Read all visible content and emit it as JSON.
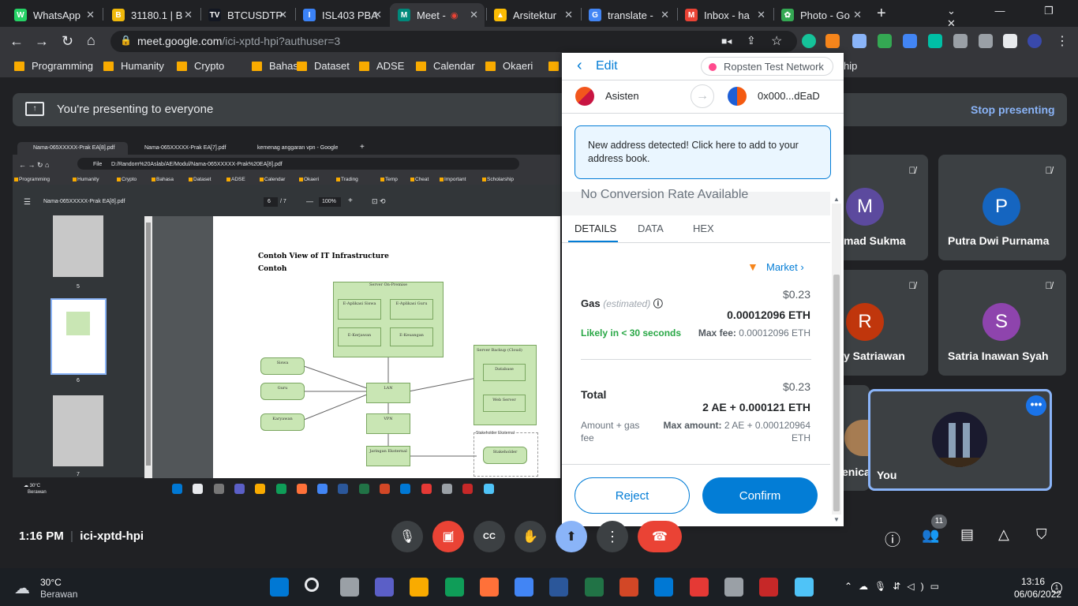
{
  "browser": {
    "tabs": [
      {
        "label": "WhatsApp",
        "color": "#25d366",
        "glyph": "W"
      },
      {
        "label": "31180.1 | B",
        "color": "#f0b90b",
        "glyph": "B"
      },
      {
        "label": "BTCUSDTP",
        "color": "#131722",
        "glyph": "TV"
      },
      {
        "label": "ISL403 PBA",
        "color": "#3b82f6",
        "glyph": "I"
      },
      {
        "label": "Meet -",
        "color": "#00897b",
        "glyph": "M"
      },
      {
        "label": "Arsitektur",
        "color": "#fbbc04",
        "glyph": "▲"
      },
      {
        "label": "translate -",
        "color": "#4285f4",
        "glyph": "G"
      },
      {
        "label": "Inbox - ha",
        "color": "#ea4335",
        "glyph": "M"
      },
      {
        "label": "Photo - Go",
        "color": "#34a853",
        "glyph": "✿"
      }
    ],
    "url_host": "meet.google.com",
    "url_path": "/ici-xptd-hpi?authuser=3",
    "bookmarks": [
      "Programming",
      "Humanity",
      "Crypto",
      "Bahasa",
      "Dataset",
      "ADSE",
      "Calendar",
      "Okaeri",
      "T"
    ],
    "bookmark_overflow": "hip"
  },
  "meet": {
    "presenting_text": "You're presenting to everyone",
    "stop_label": "Stop presenting",
    "time": "1:16 PM",
    "meeting_code": "ici-xptd-hpi",
    "people_count": "11",
    "participants": [
      {
        "initial": "M",
        "name": "mad Sukma",
        "color": "#5c4a9e"
      },
      {
        "initial": "P",
        "name": "Putra Dwi Purnama",
        "color": "#1565c0"
      },
      {
        "initial": "R",
        "name": "y Satriawan",
        "color": "#c0360c"
      },
      {
        "initial": "S",
        "name": "Satria Inawan Syah",
        "color": "#8e44ad"
      },
      {
        "initial": "",
        "name": "enica",
        "color": "#5f6368"
      }
    ],
    "you_label": "You"
  },
  "shared_screen": {
    "tabs": [
      "Nama-065XXXXX-Prak EA[8].pdf",
      "Nama-065XXXXX-Prak EA[7].pdf",
      "kemenag anggaran vpn - Google"
    ],
    "address": "D:/Random%20Aslab/AE/Modul/Nama-065XXXXX-Prak%20EA[8].pdf",
    "file_label": "File",
    "bookmarks": [
      "Programming",
      "Humanity",
      "Crypto",
      "Bahasa",
      "Dataset",
      "ADSE",
      "Calendar",
      "Okaeri",
      "Trading",
      "Temp",
      "Cheat",
      "Important",
      "Scholarship"
    ],
    "pdf_title": "Nama-065XXXXX-Prak EA[8].pdf",
    "page_current": "6",
    "page_total": "/ 7",
    "zoom": "100%",
    "thumb_labels": [
      "5",
      "6",
      "7"
    ],
    "doc_heading1": "Contoh View of IT Infrastructure",
    "doc_heading2": "Contoh",
    "diagram": {
      "server_onprem": "Server On-Premise",
      "apps": [
        "E-Aplikasi Siswa",
        "E-Aplikasi Guru",
        "E-Kerjawan",
        "E-Keuangan"
      ],
      "actors": [
        "Siswa",
        "Guru",
        "Karyawan"
      ],
      "lan": "LAN",
      "vpn": "VPN",
      "jaringan": "Jaringan Eksternal",
      "backup": "Server Backup (Cloud)",
      "database": "Database",
      "webserver": "Web Server",
      "stakeholder_group": "Stakeholder Eksternal",
      "stakeholder": "Stakeholder"
    },
    "weather_temp": "30°C",
    "weather_desc": "Berawan"
  },
  "metamask": {
    "edit_label": "Edit",
    "network": "Ropsten Test Network",
    "from_name": "Asisten",
    "to_address": "0x000...dEaD",
    "alert": "New address detected! Click here to add to your address book.",
    "conversion": "No Conversion Rate Available",
    "tabs": [
      "DETAILS",
      "DATA",
      "HEX"
    ],
    "market_label": "Market",
    "gas_label": "Gas",
    "gas_estimated": "(estimated)",
    "gas_usd": "$0.23",
    "gas_eth": "0.00012096 ETH",
    "likely": "Likely in < 30 seconds",
    "max_fee_label": "Max fee:",
    "max_fee_value": "0.00012096 ETH",
    "total_label": "Total",
    "total_usd": "$0.23",
    "total_eth": "2 AE + 0.000121 ETH",
    "amount_gas_label": "Amount + gas fee",
    "max_amount_label": "Max amount:",
    "max_amount_value": "2 AE + 0.000120964 ETH",
    "reject_label": "Reject",
    "confirm_label": "Confirm",
    "accent": "#037dd6"
  },
  "taskbar": {
    "weather_temp": "30°C",
    "weather_desc": "Berawan",
    "time": "13:16",
    "date": "06/06/2022"
  }
}
